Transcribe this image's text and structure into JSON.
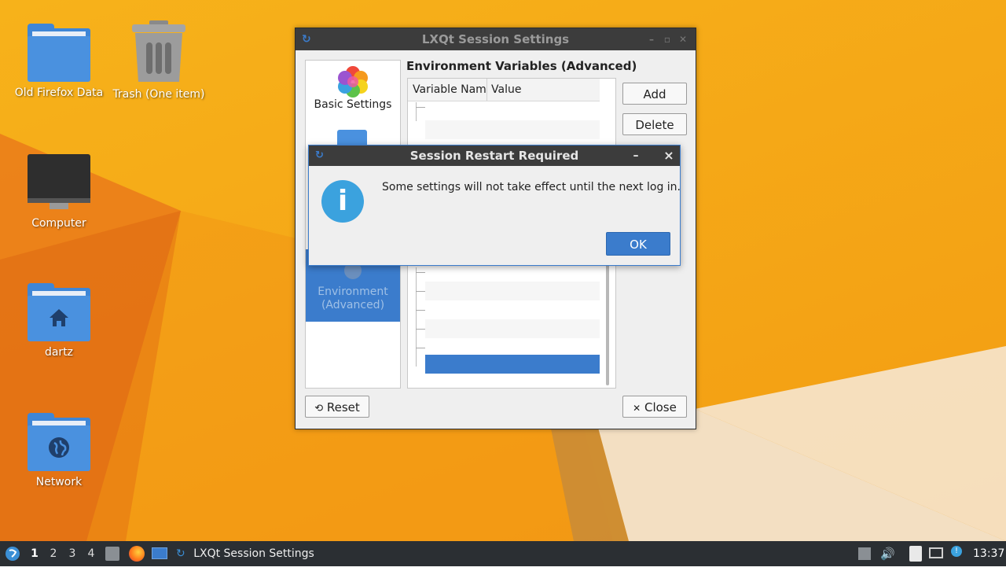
{
  "desktop": {
    "icons": [
      {
        "label": "Old Firefox Data",
        "icon": "folder-icon"
      },
      {
        "label": "Trash (One item)",
        "icon": "trash-icon"
      },
      {
        "label": "Computer",
        "icon": "computer-icon"
      },
      {
        "label": "dartz",
        "icon": "home-folder-icon"
      },
      {
        "label": "Network",
        "icon": "network-folder-icon"
      }
    ]
  },
  "session_window": {
    "title": "LXQt Session Settings",
    "sidebar": {
      "items": [
        {
          "label": "Basic Settings",
          "icon": "color-flower-icon"
        },
        {
          "label": "Environment (Advanced)",
          "icon": "gear-icon",
          "active": true
        }
      ]
    },
    "section_title": "Environment Variables (Advanced)",
    "table": {
      "columns": [
        "Variable Nam",
        "Value"
      ]
    },
    "buttons": {
      "add": "Add",
      "delete": "Delete",
      "reset": "Reset",
      "close": "Close"
    }
  },
  "dialog": {
    "title": "Session Restart Required",
    "message": "Some settings will not take effect until the next log in.",
    "ok": "OK",
    "minimize": "–",
    "close": "×"
  },
  "taskbar": {
    "desktops": [
      "1",
      "2",
      "3",
      "4"
    ],
    "active_desktop": "1",
    "task_label": "LXQt Session Settings",
    "clock": "13:37"
  },
  "colors": {
    "accent": "#3b7ccc",
    "wallpaper": "#f5a817",
    "taskbar": "#2b2f33"
  }
}
